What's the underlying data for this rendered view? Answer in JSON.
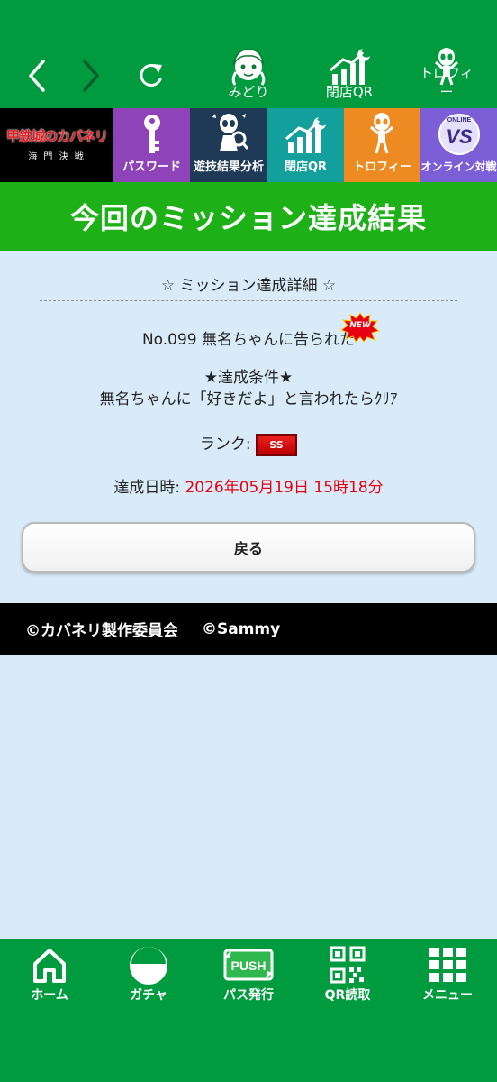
{
  "topbar": {
    "nav": [
      {
        "label": "みどり",
        "icon": "midori-icon"
      },
      {
        "label": "閉店QR",
        "icon": "closing-qr-icon"
      },
      {
        "label": "トロフィー",
        "icon": "trophy-icon"
      }
    ]
  },
  "tiles": [
    {
      "label": "",
      "logo_text": "甲鉄城のカバネリ",
      "logo_sub": "海 門 決 戦",
      "color": "#000000"
    },
    {
      "label": "パスワード",
      "color": "#8e44b8"
    },
    {
      "label": "遊技結果分析",
      "color": "#1e3a57"
    },
    {
      "label": "閉店QR",
      "color": "#13a09c"
    },
    {
      "label": "トロフィー",
      "color": "#ee8a22"
    },
    {
      "label": "オンライン対戦",
      "color": "#7c5fd6"
    }
  ],
  "banner": {
    "title": "今回のミッション達成結果"
  },
  "detail": {
    "section_title": "☆ ミッション達成詳細 ☆",
    "mission_name": "No.099 無名ちゃんに告られた",
    "new_badge": "NEW",
    "condition_heading": "★達成条件★",
    "condition_text": "無名ちゃんに「好きだよ」と言われたらｸﾘｱ",
    "rank_label": "ランク:",
    "rank_value": "SS",
    "date_label": "達成日時:",
    "date_value": "2026年05月19日 15時18分"
  },
  "back_button": {
    "label": "戻る"
  },
  "footer": {
    "copy1": "©カバネリ製作委員会",
    "copy2": "©Sammy"
  },
  "bottom_nav": [
    {
      "label": "ホーム",
      "icon": "home-icon"
    },
    {
      "label": "ガチャ",
      "icon": "gacha-icon"
    },
    {
      "label": "パス発行",
      "icon": "push-icon"
    },
    {
      "label": "QR読取",
      "icon": "qr-code-icon"
    },
    {
      "label": "メニュー",
      "icon": "menu-grid-icon"
    }
  ],
  "colors": {
    "header_green": "#009b3e",
    "banner_green": "#1db117",
    "background": "#d9ebf8",
    "date_red": "#e60012",
    "rank_red": "#cc1111"
  }
}
